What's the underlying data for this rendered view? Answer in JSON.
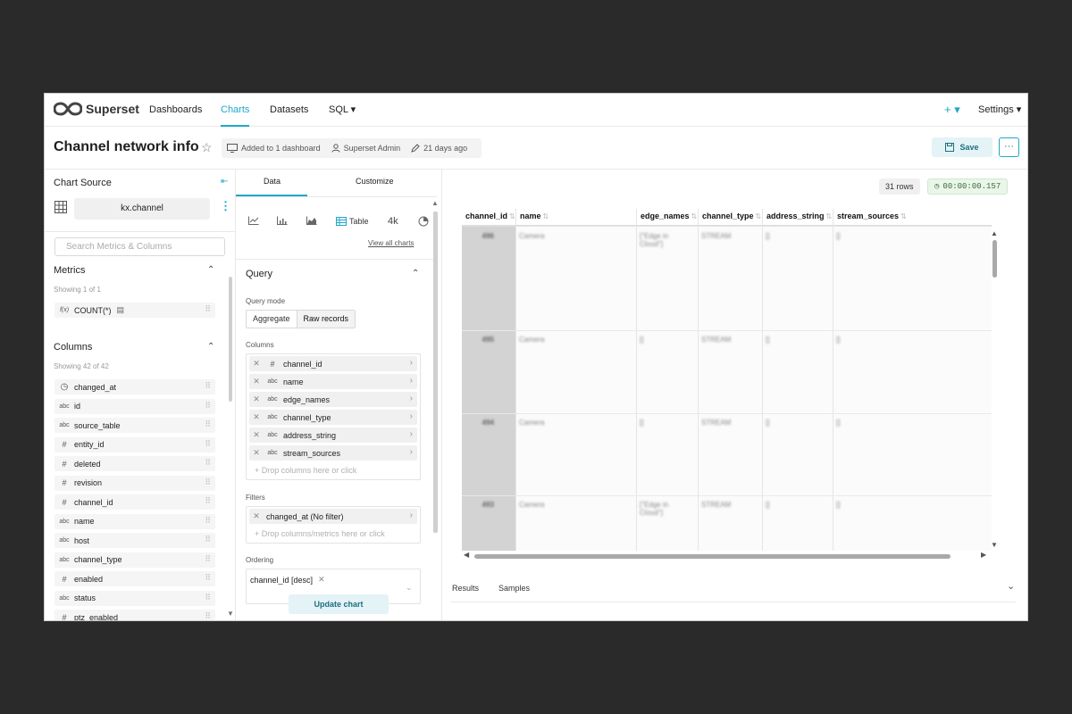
{
  "brand": {
    "name": "Superset"
  },
  "nav": {
    "items": [
      "Dashboards",
      "Charts",
      "Datasets",
      "SQL ▾"
    ],
    "active": "Charts",
    "plus": "+ ▾",
    "settings": "Settings ▾"
  },
  "header": {
    "title": "Channel network info",
    "meta": {
      "dashboards": "Added to 1 dashboard",
      "owner": "Superset Admin",
      "modified": "21 days ago"
    },
    "save_label": "Save",
    "more_label": "···"
  },
  "left": {
    "chart_source_label": "Chart Source",
    "dataset": "kx.channel",
    "search_placeholder": "Search Metrics & Columns",
    "metrics": {
      "title": "Metrics",
      "count": "Showing 1 of 1",
      "items": [
        {
          "type": "f(x)",
          "label": "COUNT(*)"
        }
      ]
    },
    "columns": {
      "title": "Columns",
      "count": "Showing 42 of 42",
      "items": [
        {
          "type": "clock",
          "label": "changed_at"
        },
        {
          "type": "abc",
          "label": "id"
        },
        {
          "type": "abc",
          "label": "source_table"
        },
        {
          "type": "#",
          "label": "entity_id"
        },
        {
          "type": "#",
          "label": "deleted"
        },
        {
          "type": "#",
          "label": "revision"
        },
        {
          "type": "#",
          "label": "channel_id"
        },
        {
          "type": "abc",
          "label": "name"
        },
        {
          "type": "abc",
          "label": "host"
        },
        {
          "type": "abc",
          "label": "channel_type"
        },
        {
          "type": "#",
          "label": "enabled"
        },
        {
          "type": "abc",
          "label": "status"
        },
        {
          "type": "#",
          "label": "ptz_enabled"
        }
      ]
    }
  },
  "middle": {
    "tabs": [
      "Data",
      "Customize"
    ],
    "viz": {
      "table_label": "Table",
      "big_number_label": "4k",
      "view_all": "View all charts"
    },
    "query": {
      "title": "Query",
      "mode_label": "Query mode",
      "modes": [
        "Aggregate",
        "Raw records"
      ],
      "active_mode": "Raw records",
      "columns_label": "Columns",
      "columns": [
        {
          "type": "#",
          "label": "channel_id"
        },
        {
          "type": "abc",
          "label": "name"
        },
        {
          "type": "abc",
          "label": "edge_names"
        },
        {
          "type": "abc",
          "label": "channel_type"
        },
        {
          "type": "abc",
          "label": "address_string"
        },
        {
          "type": "abc",
          "label": "stream_sources"
        }
      ],
      "columns_drop": "+ Drop columns here or click",
      "filters_label": "Filters",
      "filters": [
        {
          "label": "changed_at (No filter)"
        }
      ],
      "filters_drop": "+ Drop columns/metrics here or click",
      "ordering_label": "Ordering",
      "ordering": "channel_id [desc]"
    },
    "update_label": "Update chart"
  },
  "right": {
    "rows_badge": "31 rows",
    "time_badge": "00:00:00.157",
    "table": {
      "headers": [
        "channel_id",
        "name",
        "edge_names",
        "channel_type",
        "address_string",
        "stream_sources"
      ],
      "rows": [
        [
          "496",
          "Camera",
          "[\"Edge in Cloud\"]",
          "STREAM",
          "[]",
          "[]"
        ],
        [
          "495",
          "Camera",
          "[]",
          "STREAM",
          "[]",
          "[]"
        ],
        [
          "494",
          "Camera",
          "[]",
          "STREAM",
          "[]",
          "[]"
        ],
        [
          "493",
          "Camera",
          "[\"Edge in Cloud\"]",
          "STREAM",
          "[]",
          "[]"
        ]
      ]
    },
    "tabs": [
      "Results",
      "Samples"
    ]
  },
  "colors": {
    "accent": "#20a7c9",
    "accent_dark": "#1e6f82",
    "id_column": "#d3d3d3",
    "frame": "#2a2a2a"
  }
}
